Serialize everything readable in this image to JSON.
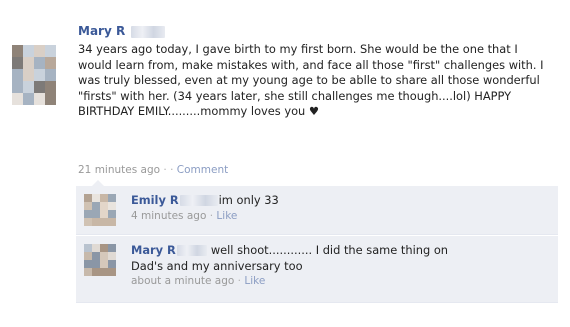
{
  "post": {
    "author": "Mary R",
    "lines": [
      "34 years ago today, I gave birth to my first born. She would be the one that I",
      "would learn from, make mistakes with, and face all those \"first\" challenges with. I",
      "was truly blessed, even at my young age to be ablle to share all those wonderful",
      "\"firsts\" with her. (34 years later, she still challenges me though....lol) HAPPY",
      "BIRTHDAY EMILY.........mommy loves you ♥"
    ],
    "timestamp": "21 minutes ago",
    "separator": "·",
    "comment_link": "Comment",
    "avatar_icon": "blurred-profile-photo"
  },
  "comments": [
    {
      "author": "Emily R",
      "text": "im only 33",
      "timestamp": "4 minutes ago",
      "separator": "·",
      "like_link": "Like",
      "avatar_icon": "blurred-profile-photo"
    },
    {
      "author": "Mary R",
      "line1": "well shoot............ I did the same thing on",
      "line2": "Dad's and my anniversary too",
      "timestamp": "about a minute ago",
      "separator": "·",
      "like_link": "Like",
      "avatar_icon": "blurred-profile-photo"
    }
  ],
  "colors": {
    "name_link": "#3b5998",
    "comment_bg": "#edeff4",
    "meta_gray": "#999999",
    "action_link": "#8b9dc3"
  }
}
